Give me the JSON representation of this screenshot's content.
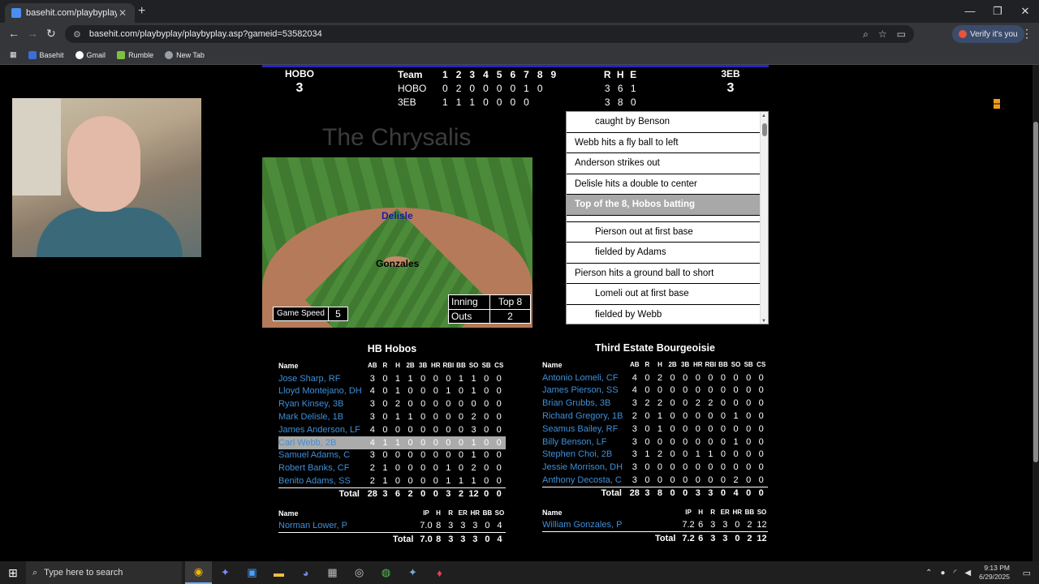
{
  "browser": {
    "tab_title": "basehit.com/playbyplay/playbyp",
    "url": "basehit.com/playbyplay/playbyplay.asp?gameid=53582034",
    "verify_label": "Verify it's you",
    "bookmarks": [
      {
        "label": "Basehit",
        "color": "#3b6ed6"
      },
      {
        "label": "Gmail",
        "color": "#ffffff"
      },
      {
        "label": "Rumble",
        "color": "#7ec141"
      },
      {
        "label": "New Tab",
        "color": "#9aa0a6"
      }
    ]
  },
  "scoreboard": {
    "away": {
      "abbr": "HOBO",
      "score": "3"
    },
    "home": {
      "abbr": "3EB",
      "score": "3"
    },
    "header": {
      "team": "Team",
      "innings": [
        "1",
        "2",
        "3",
        "4",
        "5",
        "6",
        "7",
        "8",
        "9"
      ],
      "rhe": [
        "R",
        "H",
        "E"
      ]
    },
    "rows": [
      {
        "team": "HOBO",
        "innings": [
          "0",
          "2",
          "0",
          "0",
          "0",
          "0",
          "1",
          "0",
          ""
        ],
        "rhe": [
          "3",
          "6",
          "1"
        ]
      },
      {
        "team": "3EB",
        "innings": [
          "1",
          "1",
          "1",
          "0",
          "0",
          "0",
          "0",
          "",
          ""
        ],
        "rhe": [
          "3",
          "8",
          "0"
        ]
      }
    ]
  },
  "stadium": "The Chrysalis",
  "field": {
    "fielder_cf": "Delisle",
    "pitcher": "Gonzales",
    "game_speed_label": "Game Speed",
    "game_speed": "5",
    "inning_label": "Inning",
    "inning_value": "Top 8",
    "outs_label": "Outs",
    "outs_value": "2"
  },
  "pbp": [
    {
      "text": "caught by Benson",
      "indent": true
    },
    {
      "text": "Webb hits a fly ball to left",
      "indent": false
    },
    {
      "text": "Anderson strikes out",
      "indent": false
    },
    {
      "text": "Delisle hits a double to center",
      "indent": false
    },
    {
      "text": "Top of the 8, Hobos batting",
      "indent": false,
      "highlight": true
    },
    {
      "text": "",
      "blank": true
    },
    {
      "text": "Pierson out at first base",
      "indent": true
    },
    {
      "text": "fielded by Adams",
      "indent": true
    },
    {
      "text": "Pierson hits a ground ball to short",
      "indent": false
    },
    {
      "text": "Lomeli out at first base",
      "indent": true
    },
    {
      "text": "fielded by Webb",
      "indent": true
    }
  ],
  "away_box": {
    "title": "HB Hobos",
    "cols": [
      "AB",
      "R",
      "H",
      "2B",
      "3B",
      "HR",
      "RBI",
      "BB",
      "SO",
      "SB",
      "CS"
    ],
    "name_label": "Name",
    "rows": [
      {
        "name": "Jose Sharp, RF",
        "stats": [
          "3",
          "0",
          "1",
          "1",
          "0",
          "0",
          "0",
          "1",
          "1",
          "0",
          "0"
        ]
      },
      {
        "name": "Lloyd Montejano, DH",
        "stats": [
          "4",
          "0",
          "1",
          "0",
          "0",
          "0",
          "1",
          "0",
          "1",
          "0",
          "0"
        ]
      },
      {
        "name": "Ryan Kinsey, 3B",
        "stats": [
          "3",
          "0",
          "2",
          "0",
          "0",
          "0",
          "0",
          "0",
          "0",
          "0",
          "0"
        ]
      },
      {
        "name": "Mark Delisle, 1B",
        "stats": [
          "3",
          "0",
          "1",
          "1",
          "0",
          "0",
          "0",
          "0",
          "2",
          "0",
          "0"
        ]
      },
      {
        "name": "James Anderson, LF",
        "stats": [
          "4",
          "0",
          "0",
          "0",
          "0",
          "0",
          "0",
          "0",
          "3",
          "0",
          "0"
        ]
      },
      {
        "name": "Carl Webb, 2B",
        "stats": [
          "4",
          "1",
          "1",
          "0",
          "0",
          "0",
          "0",
          "0",
          "1",
          "0",
          "0"
        ],
        "selected": true
      },
      {
        "name": "Samuel Adams, C",
        "stats": [
          "3",
          "0",
          "0",
          "0",
          "0",
          "0",
          "0",
          "0",
          "1",
          "0",
          "0"
        ]
      },
      {
        "name": "Robert Banks, CF",
        "stats": [
          "2",
          "1",
          "0",
          "0",
          "0",
          "0",
          "1",
          "0",
          "2",
          "0",
          "0"
        ]
      },
      {
        "name": "Benito Adams, SS",
        "stats": [
          "2",
          "1",
          "0",
          "0",
          "0",
          "0",
          "1",
          "1",
          "1",
          "0",
          "0"
        ]
      }
    ],
    "total_label": "Total",
    "total": [
      "28",
      "3",
      "6",
      "2",
      "0",
      "0",
      "3",
      "2",
      "12",
      "0",
      "0"
    ],
    "pitch_cols": [
      "IP",
      "H",
      "R",
      "ER",
      "HR",
      "BB",
      "SO"
    ],
    "pitchers": [
      {
        "name": "Norman Lower, P",
        "stats": [
          "7.0",
          "8",
          "3",
          "3",
          "3",
          "0",
          "4"
        ]
      }
    ],
    "pitch_total": [
      "7.0",
      "8",
      "3",
      "3",
      "3",
      "0",
      "4"
    ]
  },
  "home_box": {
    "title": "Third Estate Bourgeoisie",
    "cols": [
      "AB",
      "R",
      "H",
      "2B",
      "3B",
      "HR",
      "RBI",
      "BB",
      "SO",
      "SB",
      "CS"
    ],
    "name_label": "Name",
    "rows": [
      {
        "name": "Antonio Lomeli, CF",
        "stats": [
          "4",
          "0",
          "2",
          "0",
          "0",
          "0",
          "0",
          "0",
          "0",
          "0",
          "0"
        ]
      },
      {
        "name": "James Pierson, SS",
        "stats": [
          "4",
          "0",
          "0",
          "0",
          "0",
          "0",
          "0",
          "0",
          "0",
          "0",
          "0"
        ]
      },
      {
        "name": "Brian Grubbs, 3B",
        "stats": [
          "3",
          "2",
          "2",
          "0",
          "0",
          "2",
          "2",
          "0",
          "0",
          "0",
          "0"
        ]
      },
      {
        "name": "Richard Gregory, 1B",
        "stats": [
          "2",
          "0",
          "1",
          "0",
          "0",
          "0",
          "0",
          "0",
          "1",
          "0",
          "0"
        ]
      },
      {
        "name": "Seamus Bailey, RF",
        "stats": [
          "3",
          "0",
          "1",
          "0",
          "0",
          "0",
          "0",
          "0",
          "0",
          "0",
          "0"
        ]
      },
      {
        "name": "Billy Benson, LF",
        "stats": [
          "3",
          "0",
          "0",
          "0",
          "0",
          "0",
          "0",
          "0",
          "1",
          "0",
          "0"
        ]
      },
      {
        "name": "Stephen Choi, 2B",
        "stats": [
          "3",
          "1",
          "2",
          "0",
          "0",
          "1",
          "1",
          "0",
          "0",
          "0",
          "0"
        ]
      },
      {
        "name": "Jessie Morrison, DH",
        "stats": [
          "3",
          "0",
          "0",
          "0",
          "0",
          "0",
          "0",
          "0",
          "0",
          "0",
          "0"
        ]
      },
      {
        "name": "Anthony Decosta, C",
        "stats": [
          "3",
          "0",
          "0",
          "0",
          "0",
          "0",
          "0",
          "0",
          "2",
          "0",
          "0"
        ]
      }
    ],
    "total_label": "Total",
    "total": [
      "28",
      "3",
      "8",
      "0",
      "0",
      "3",
      "3",
      "0",
      "4",
      "0",
      "0"
    ],
    "pitch_cols": [
      "IP",
      "H",
      "R",
      "ER",
      "HR",
      "BB",
      "SO"
    ],
    "pitchers": [
      {
        "name": "William Gonzales, P",
        "stats": [
          "7.2",
          "6",
          "3",
          "3",
          "0",
          "2",
          "12"
        ]
      }
    ],
    "pitch_total": [
      "7.2",
      "6",
      "3",
      "3",
      "0",
      "2",
      "12"
    ]
  },
  "taskbar": {
    "search_placeholder": "Type here to search",
    "time": "9:13 PM",
    "date": "6/29/2025"
  }
}
